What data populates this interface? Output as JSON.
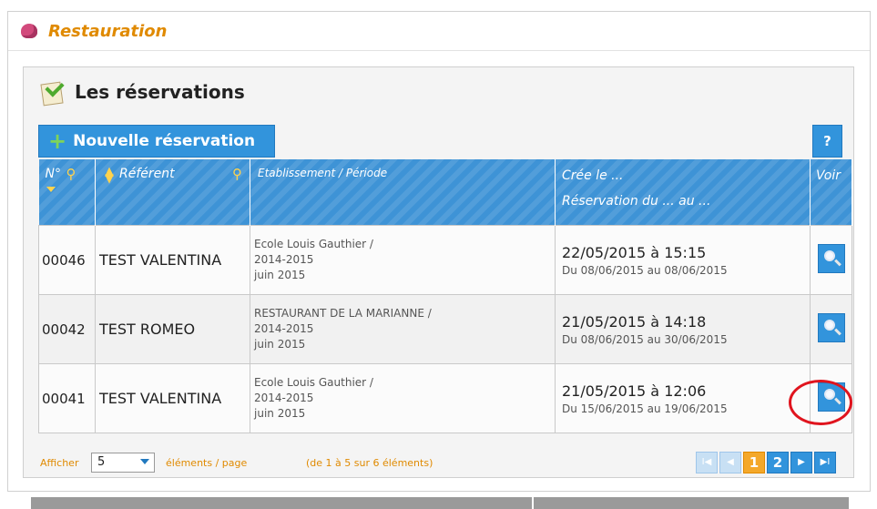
{
  "app": {
    "title": "Restauration"
  },
  "panel": {
    "title": "Les réservations"
  },
  "toolbar": {
    "new_label": "Nouvelle réservation",
    "help_label": "?"
  },
  "table": {
    "headers": {
      "num": "N°",
      "referent": "Référent",
      "estab": "Etablissement / Période",
      "created_line1": "Crée le ...",
      "created_line2": "Réservation du ... au ...",
      "voir": "Voir"
    },
    "rows": [
      {
        "num": "00046",
        "referent": "TEST VALENTINA",
        "estab_line1": "Ecole Louis Gauthier /",
        "estab_line2": "2014-2015",
        "estab_line3": "juin 2015",
        "created": "22/05/2015 à 15:15",
        "period": "Du 08/06/2015 au 08/06/2015"
      },
      {
        "num": "00042",
        "referent": "TEST ROMEO",
        "estab_line1": "RESTAURANT DE LA MARIANNE /",
        "estab_line2": "2014-2015",
        "estab_line3": "juin 2015",
        "created": "21/05/2015 à 14:18",
        "period": "Du 08/06/2015 au 30/06/2015"
      },
      {
        "num": "00041",
        "referent": "TEST VALENTINA",
        "estab_line1": "Ecole Louis Gauthier /",
        "estab_line2": "2014-2015",
        "estab_line3": "juin 2015",
        "created": "21/05/2015 à 12:06",
        "period": "Du 15/06/2015 au 19/06/2015"
      }
    ]
  },
  "footer": {
    "show_label": "Afficher",
    "page_size": "5",
    "per_page_label": "éléments / page",
    "range_text": "(de 1 à 5 sur 6 éléments)"
  },
  "pager": {
    "first": "I◀",
    "prev": "◀",
    "pages": [
      "1",
      "2"
    ],
    "current_page": "1",
    "next": "▶",
    "last": "▶I"
  },
  "colors": {
    "accent": "#3294dc",
    "title_orange": "#e08a00",
    "highlight_red": "#e0141e"
  },
  "icons": [
    "app-logo-icon",
    "reservations-icon",
    "plus-icon",
    "magnifier-icon",
    "sort-icon",
    "dropdown-chevron-icon"
  ]
}
